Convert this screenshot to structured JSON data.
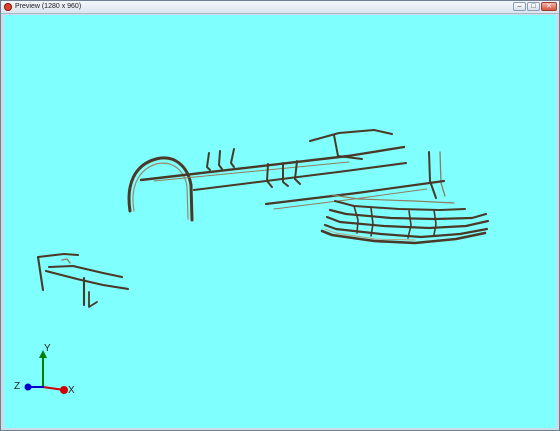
{
  "window": {
    "title": "Preview (1280 x 960)",
    "controls": {
      "minimize": "–",
      "maximize": "□",
      "close": "✕"
    }
  },
  "viewport": {
    "background": "#80ffff",
    "pipe_color": "#5a4630",
    "axes": {
      "x_label": "X",
      "y_label": "Y",
      "z_label": "Z",
      "x_color": "#d00000",
      "y_color": "#008000",
      "z_color": "#0000d0"
    }
  }
}
